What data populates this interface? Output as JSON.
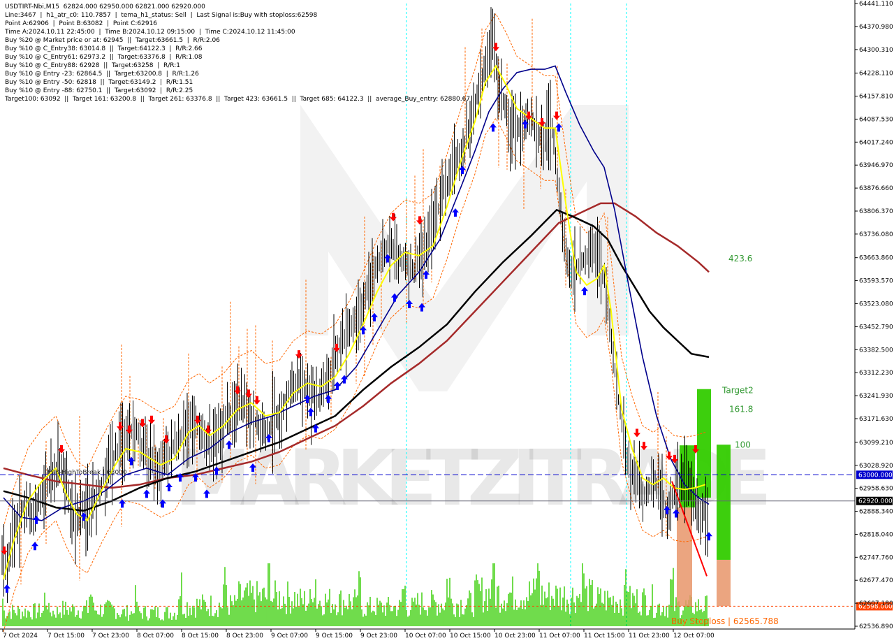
{
  "header": {
    "lines": [
      "USDTIRT-Nbi,M15  62824.000 62950.000 62821.000 62920.000",
      "Line:3467  |  h1_atr_c0: 110.7857  |  tema_h1_status: Sell  |  Last Signal is:Buy with stoploss:62598",
      "Point A:62906  |  Point B:63082  |  Point C:62916",
      "Time A:2024.10.11 22:45:00  |  Time B:2024.10.12 09:15:00  |  Time C:2024.10.12 11:45:00",
      "Buy %20 @ Market price or at: 62945  ||  Target:63661.5  |  R/R:2.06",
      "Buy %10 @ C_Entry38: 63014.8  ||  Target:64122.3  |  R/R:2.66",
      "Buy %10 @ C_Entry61: 62973.2  ||  Target:63376.8  |  R/R:1.08",
      "Buy %10 @ C_Entry88: 62928  ||  Target:63258  |  R/R:1",
      "Buy %10 @ Entry -23: 62864.5  ||  Target:63200.8  |  R/R:1.26",
      "Buy %10 @ Entry -50: 62818  ||  Target:63149.2  |  R/R:1.51",
      "Buy %10 @ Entry -88: 62750.1  ||  Target:63092  |  R/R:2.25",
      "Target100: 63092  ||  Target 161: 63200.8  ||  Target 261: 63376.8  ||  Target 423: 63661.5  ||  Target 685: 64122.3  ||  average_Buy_entry: 62880.67"
    ]
  },
  "chart_data": {
    "type": "candlestick",
    "symbol": "USDTIRT-Nbi,M15",
    "ylim": [
      62536.89,
      64441.11
    ],
    "price_ticks": [
      "64441.110",
      "64370.980",
      "64300.310",
      "64228.110",
      "64157.810",
      "64087.530",
      "64017.240",
      "63946.970",
      "63876.660",
      "63806.370",
      "63736.080",
      "63663.860",
      "63593.570",
      "63523.080",
      "63452.790",
      "63382.500",
      "63312.230",
      "63241.930",
      "63171.630",
      "63099.210",
      "63028.920",
      "62958.630",
      "62888.340",
      "62818.040",
      "62747.760",
      "62677.470",
      "62607.180",
      "62536.890"
    ],
    "time_ticks": [
      "7 Oct 2024",
      "7 Oct 15:00",
      "7 Oct 23:00",
      "8 Oct 07:00",
      "8 Oct 15:00",
      "8 Oct 23:00",
      "9 Oct 07:00",
      "9 Oct 15:00",
      "9 Oct 23:00",
      "10 Oct 07:00",
      "10 Oct 15:00",
      "10 Oct 23:00",
      "11 Oct 07:00",
      "11 Oct 15:00",
      "11 Oct 23:00",
      "12 Oct 07:00"
    ],
    "current_price": {
      "value": 62920.0,
      "label": "62920.000"
    },
    "level_63000": {
      "value": 63000.0,
      "label": "63000.000"
    },
    "stoploss": {
      "value": 62598.0,
      "label": "62598.000",
      "text": "Buy Stoploss | 62565.788"
    },
    "fsb_label": "FSB-HighToBreak | 63000",
    "fib_labels": {
      "t423": "423.6",
      "target2": "Target2",
      "t161": "161.8",
      "t100": "100"
    },
    "watermark": "MARKETZITRADE",
    "close_path": [
      [
        0,
        62780
      ],
      [
        10,
        62700
      ],
      [
        20,
        62820
      ],
      [
        35,
        62910
      ],
      [
        50,
        62880
      ],
      [
        60,
        62960
      ],
      [
        75,
        62990
      ],
      [
        90,
        63030
      ],
      [
        105,
        62860
      ],
      [
        120,
        62880
      ],
      [
        140,
        62940
      ],
      [
        160,
        63050
      ],
      [
        180,
        63120
      ],
      [
        195,
        63130
      ],
      [
        210,
        63060
      ],
      [
        225,
        63020
      ],
      [
        240,
        63060
      ],
      [
        260,
        63120
      ],
      [
        275,
        63160
      ],
      [
        290,
        63120
      ],
      [
        305,
        63080
      ],
      [
        320,
        63150
      ],
      [
        335,
        63200
      ],
      [
        350,
        63220
      ],
      [
        365,
        63160
      ],
      [
        380,
        63120
      ],
      [
        395,
        63180
      ],
      [
        410,
        63240
      ],
      [
        425,
        63290
      ],
      [
        440,
        63260
      ],
      [
        455,
        63230
      ],
      [
        470,
        63300
      ],
      [
        485,
        63390
      ],
      [
        500,
        63450
      ],
      [
        515,
        63500
      ],
      [
        530,
        63580
      ],
      [
        545,
        63660
      ],
      [
        560,
        63710
      ],
      [
        575,
        63660
      ],
      [
        590,
        63620
      ],
      [
        605,
        63680
      ],
      [
        620,
        63760
      ],
      [
        635,
        63860
      ],
      [
        650,
        63940
      ],
      [
        665,
        64010
      ],
      [
        680,
        64120
      ],
      [
        695,
        64260
      ],
      [
        705,
        64320
      ],
      [
        715,
        64170
      ],
      [
        730,
        64080
      ],
      [
        745,
        64050
      ],
      [
        760,
        64090
      ],
      [
        775,
        64020
      ],
      [
        790,
        64060
      ],
      [
        800,
        63860
      ],
      [
        810,
        63680
      ],
      [
        820,
        63600
      ],
      [
        835,
        63660
      ],
      [
        850,
        63700
      ],
      [
        865,
        63600
      ],
      [
        875,
        63420
      ],
      [
        885,
        63240
      ],
      [
        895,
        63080
      ],
      [
        905,
        63000
      ],
      [
        915,
        62960
      ],
      [
        925,
        62940
      ],
      [
        935,
        62980
      ],
      [
        945,
        62960
      ],
      [
        955,
        62890
      ],
      [
        965,
        62930
      ],
      [
        975,
        62970
      ],
      [
        985,
        62990
      ],
      [
        995,
        62920
      ],
      [
        1005,
        62870
      ],
      [
        1015,
        62920
      ]
    ],
    "yellow_line": [
      [
        5,
        62680
      ],
      [
        20,
        62800
      ],
      [
        40,
        62920
      ],
      [
        60,
        62980
      ],
      [
        80,
        63020
      ],
      [
        95,
        62940
      ],
      [
        110,
        62880
      ],
      [
        125,
        62860
      ],
      [
        145,
        62950
      ],
      [
        165,
        63030
      ],
      [
        180,
        63080
      ],
      [
        200,
        63070
      ],
      [
        215,
        63050
      ],
      [
        230,
        63030
      ],
      [
        250,
        63050
      ],
      [
        270,
        63130
      ],
      [
        285,
        63150
      ],
      [
        300,
        63120
      ],
      [
        320,
        63150
      ],
      [
        340,
        63200
      ],
      [
        360,
        63220
      ],
      [
        380,
        63180
      ],
      [
        400,
        63190
      ],
      [
        420,
        63250
      ],
      [
        440,
        63280
      ],
      [
        460,
        63270
      ],
      [
        480,
        63300
      ],
      [
        500,
        63370
      ],
      [
        520,
        63460
      ],
      [
        540,
        63560
      ],
      [
        560,
        63640
      ],
      [
        580,
        63680
      ],
      [
        600,
        63670
      ],
      [
        620,
        63700
      ],
      [
        640,
        63820
      ],
      [
        660,
        63960
      ],
      [
        680,
        64080
      ],
      [
        695,
        64200
      ],
      [
        710,
        64250
      ],
      [
        725,
        64190
      ],
      [
        740,
        64120
      ],
      [
        760,
        64090
      ],
      [
        780,
        64060
      ],
      [
        795,
        64060
      ],
      [
        810,
        63830
      ],
      [
        825,
        63620
      ],
      [
        840,
        63580
      ],
      [
        855,
        63600
      ],
      [
        865,
        63640
      ],
      [
        875,
        63500
      ],
      [
        890,
        63200
      ],
      [
        905,
        63080
      ],
      [
        920,
        62990
      ],
      [
        935,
        62970
      ],
      [
        950,
        62990
      ],
      [
        965,
        62960
      ],
      [
        980,
        62955
      ],
      [
        995,
        62960
      ],
      [
        1010,
        62970
      ]
    ],
    "blue_line": [
      [
        5,
        62930
      ],
      [
        30,
        62870
      ],
      [
        60,
        62860
      ],
      [
        90,
        62900
      ],
      [
        120,
        62920
      ],
      [
        150,
        62950
      ],
      [
        180,
        63000
      ],
      [
        210,
        63020
      ],
      [
        240,
        63000
      ],
      [
        270,
        63050
      ],
      [
        300,
        63080
      ],
      [
        330,
        63130
      ],
      [
        360,
        63160
      ],
      [
        390,
        63180
      ],
      [
        420,
        63210
      ],
      [
        450,
        63240
      ],
      [
        480,
        63260
      ],
      [
        510,
        63330
      ],
      [
        540,
        63440
      ],
      [
        570,
        63550
      ],
      [
        600,
        63620
      ],
      [
        630,
        63720
      ],
      [
        660,
        63880
      ],
      [
        680,
        63990
      ],
      [
        700,
        64110
      ],
      [
        720,
        64180
      ],
      [
        740,
        64230
      ],
      [
        760,
        64240
      ],
      [
        780,
        64240
      ],
      [
        795,
        64250
      ],
      [
        810,
        64170
      ],
      [
        830,
        64070
      ],
      [
        850,
        63990
      ],
      [
        865,
        63940
      ],
      [
        880,
        63810
      ],
      [
        900,
        63580
      ],
      [
        920,
        63360
      ],
      [
        940,
        63180
      ],
      [
        960,
        63050
      ],
      [
        980,
        62970
      ],
      [
        1000,
        62930
      ],
      [
        1015,
        62910
      ]
    ],
    "black_line": [
      [
        5,
        62950
      ],
      [
        40,
        62930
      ],
      [
        80,
        62900
      ],
      [
        120,
        62890
      ],
      [
        160,
        62920
      ],
      [
        200,
        62960
      ],
      [
        240,
        62990
      ],
      [
        280,
        63010
      ],
      [
        320,
        63040
      ],
      [
        360,
        63070
      ],
      [
        400,
        63100
      ],
      [
        440,
        63140
      ],
      [
        480,
        63180
      ],
      [
        520,
        63260
      ],
      [
        560,
        63330
      ],
      [
        600,
        63390
      ],
      [
        640,
        63460
      ],
      [
        680,
        63560
      ],
      [
        720,
        63650
      ],
      [
        760,
        63730
      ],
      [
        797,
        63810
      ],
      [
        820,
        63790
      ],
      [
        850,
        63760
      ],
      [
        870,
        63720
      ],
      [
        890,
        63640
      ],
      [
        910,
        63570
      ],
      [
        930,
        63500
      ],
      [
        950,
        63450
      ],
      [
        970,
        63410
      ],
      [
        990,
        63370
      ],
      [
        1015,
        63360
      ]
    ],
    "red_line": [
      [
        5,
        63020
      ],
      [
        40,
        63000
      ],
      [
        80,
        62980
      ],
      [
        120,
        62970
      ],
      [
        160,
        62960
      ],
      [
        200,
        62970
      ],
      [
        240,
        62990
      ],
      [
        280,
        63000
      ],
      [
        320,
        63020
      ],
      [
        360,
        63040
      ],
      [
        400,
        63070
      ],
      [
        440,
        63110
      ],
      [
        480,
        63150
      ],
      [
        520,
        63210
      ],
      [
        560,
        63280
      ],
      [
        600,
        63340
      ],
      [
        640,
        63410
      ],
      [
        680,
        63500
      ],
      [
        720,
        63590
      ],
      [
        760,
        63680
      ],
      [
        800,
        63770
      ],
      [
        830,
        63800
      ],
      [
        860,
        63830
      ],
      [
        880,
        63830
      ],
      [
        910,
        63790
      ],
      [
        940,
        63740
      ],
      [
        970,
        63700
      ],
      [
        1000,
        63650
      ],
      [
        1015,
        63620
      ]
    ],
    "buy_arrows": [
      [
        10,
        62650
      ],
      [
        50,
        62780
      ],
      [
        52,
        62860
      ],
      [
        120,
        62870
      ],
      [
        175,
        62910
      ],
      [
        188,
        63040
      ],
      [
        210,
        62940
      ],
      [
        233,
        62910
      ],
      [
        242,
        62960
      ],
      [
        258,
        62990
      ],
      [
        280,
        62990
      ],
      [
        296,
        62940
      ],
      [
        310,
        63010
      ],
      [
        328,
        63090
      ],
      [
        362,
        63020
      ],
      [
        385,
        63110
      ],
      [
        440,
        63230
      ],
      [
        445,
        63190
      ],
      [
        452,
        63140
      ],
      [
        470,
        63230
      ],
      [
        483,
        63270
      ],
      [
        493,
        63290
      ],
      [
        520,
        63440
      ],
      [
        536,
        63480
      ],
      [
        555,
        63660
      ],
      [
        565,
        63540
      ],
      [
        586,
        63520
      ],
      [
        604,
        63510
      ],
      [
        610,
        63610
      ],
      [
        652,
        63800
      ],
      [
        662,
        63930
      ],
      [
        706,
        64060
      ],
      [
        752,
        64070
      ],
      [
        800,
        64060
      ],
      [
        837,
        63560
      ],
      [
        955,
        62890
      ],
      [
        968,
        62880
      ],
      [
        1015,
        62810
      ]
    ],
    "sell_arrows": [
      [
        6,
        62770
      ],
      [
        88,
        63080
      ],
      [
        172,
        63150
      ],
      [
        185,
        63140
      ],
      [
        204,
        63160
      ],
      [
        217,
        63170
      ],
      [
        238,
        63110
      ],
      [
        283,
        63170
      ],
      [
        298,
        63140
      ],
      [
        340,
        63260
      ],
      [
        356,
        63250
      ],
      [
        368,
        63230
      ],
      [
        428,
        63370
      ],
      [
        482,
        63390
      ],
      [
        563,
        63790
      ],
      [
        601,
        63780
      ],
      [
        710,
        64310
      ],
      [
        757,
        64100
      ],
      [
        776,
        64080
      ],
      [
        797,
        64100
      ],
      [
        912,
        63130
      ],
      [
        922,
        63090
      ],
      [
        958,
        63060
      ],
      [
        966,
        63050
      ],
      [
        996,
        63080
      ]
    ],
    "volume_pattern": [
      28,
      32,
      26,
      40,
      55,
      48,
      36,
      44,
      62,
      58,
      50,
      38
    ]
  },
  "colors": {
    "background": "#ffffff",
    "bull_bear_bars": "#000000",
    "yellow": "#ffff00",
    "blue": "#00008b",
    "black": "#000000",
    "darkred": "#a52a2a",
    "envelope": "#ff6600",
    "buy_arrow": "#0000ff",
    "sell_arrow": "#ff0000",
    "volume": "#33cc00",
    "green_box": "#33cc00",
    "orange_box": "#e8956a",
    "cyan_vline": "#00ffff",
    "current_price_bg": "#000000",
    "level_bg": "#0000cd",
    "stoploss_bg": "#ff4400",
    "label_green": "#339933",
    "stoploss_text": "#ff6600"
  }
}
